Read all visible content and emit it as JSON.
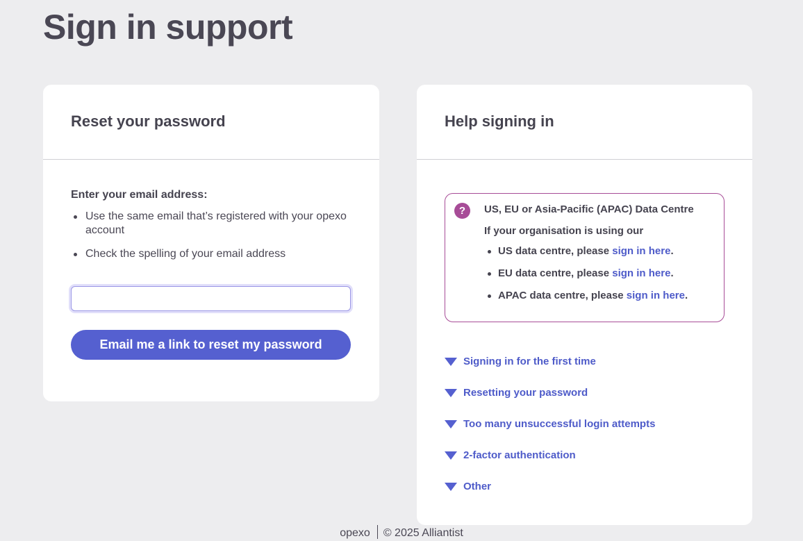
{
  "page": {
    "title": "Sign in support"
  },
  "reset": {
    "heading": "Reset your password",
    "lead": "Enter your email address:",
    "bullets": [
      "Use the same email that’s registered with your opexo account",
      "Check the spelling of your email address"
    ],
    "email_value": "",
    "button_label": "Email me a link to reset my password"
  },
  "help": {
    "heading": "Help signing in",
    "notice": {
      "icon": "question-icon",
      "icon_glyph": "?",
      "title": "US, EU or Asia-Pacific (APAC) Data Centre",
      "intro": "If your organisation is using our",
      "items": [
        {
          "prefix": "US data centre, please ",
          "link": "sign in here",
          "suffix": "."
        },
        {
          "prefix": "EU data centre, please ",
          "link": "sign in here",
          "suffix": "."
        },
        {
          "prefix": "APAC data centre, please ",
          "link": "sign in here",
          "suffix": "."
        }
      ]
    },
    "accordion": [
      {
        "label": "Signing in for the first time",
        "icon": "caret-down-icon"
      },
      {
        "label": "Resetting your password",
        "icon": "caret-down-icon"
      },
      {
        "label": "Too many unsuccessful login attempts",
        "icon": "caret-down-icon"
      },
      {
        "label": "2-factor authentication",
        "icon": "caret-down-icon"
      },
      {
        "label": "Other",
        "icon": "caret-down-icon"
      }
    ]
  },
  "footer": {
    "brand": "opexo",
    "copyright": "© 2025 Alliantist"
  },
  "colors": {
    "background": "#ededef",
    "primary": "#5560d0",
    "link": "#4e5bc9",
    "notice_border": "#a74c97",
    "text": "#45434f"
  }
}
